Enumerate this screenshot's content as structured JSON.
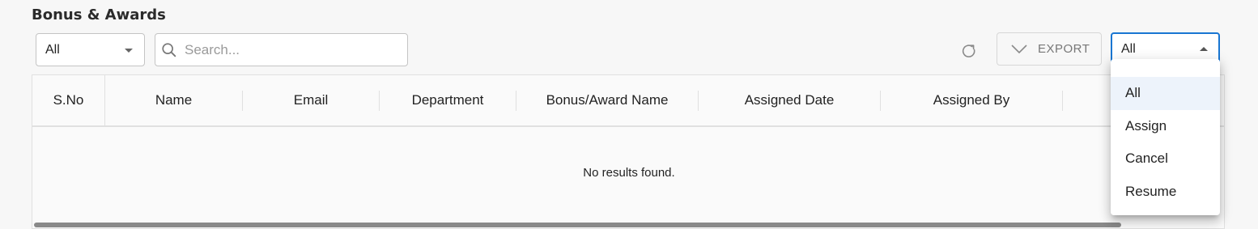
{
  "page": {
    "title": "Bonus & Awards"
  },
  "filter_left": {
    "value": "All",
    "icon": "arrow-drop-down-icon"
  },
  "search": {
    "placeholder": "Search...",
    "value": "",
    "icon": "search-icon"
  },
  "toolbar": {
    "refresh_icon": "refresh-icon",
    "export_label": "EXPORT",
    "export_icon": "chevron-down-icon"
  },
  "filter_right": {
    "value": "All",
    "icon": "arrow-drop-up-icon",
    "options": [
      "All",
      "Assign",
      "Cancel",
      "Resume"
    ],
    "selected_index": 0
  },
  "table": {
    "columns": [
      "S.No",
      "Name",
      "Email",
      "Department",
      "Bonus/Award Name",
      "Assigned Date",
      "Assigned By"
    ],
    "rows": [],
    "empty_message": "No results found."
  },
  "colors": {
    "accent": "#1976d2",
    "background": "#f7f7f7",
    "selected_option": "#edf3fb"
  }
}
